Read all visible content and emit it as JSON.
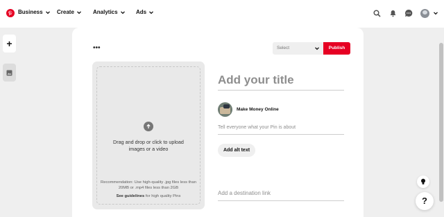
{
  "nav": {
    "items": [
      {
        "label": "Business"
      },
      {
        "label": "Create"
      },
      {
        "label": "Analytics"
      },
      {
        "label": "Ads"
      }
    ]
  },
  "rail": {
    "add_label": "+"
  },
  "toolbar": {
    "more_label": "•••",
    "select_placeholder": "Select",
    "publish_label": "Publish"
  },
  "upload": {
    "instruction": "Drag and drop or click to upload images or a video",
    "recommendation": "Recommendation: Use high-quality .jpg files less than 20MB or .mp4 files less than 2GB",
    "guidelines_link": "See guidelines",
    "guidelines_rest": "for high quality Pins"
  },
  "pin": {
    "title_placeholder": "Add your title",
    "user_name": "Make Money Online",
    "description_placeholder": "Tell everyone what your Pin is about",
    "alt_text_button": "Add alt text",
    "link_placeholder": "Add a destination link"
  },
  "help": {
    "label": "?"
  },
  "colors": {
    "brand": "#e60023",
    "background": "#efefef"
  },
  "icons": [
    "pinterest-logo-icon",
    "chevron-down-icon",
    "search-icon",
    "bell-icon",
    "chat-icon",
    "avatar",
    "image-icon",
    "upload-arrow-icon",
    "lightbulb-icon"
  ]
}
